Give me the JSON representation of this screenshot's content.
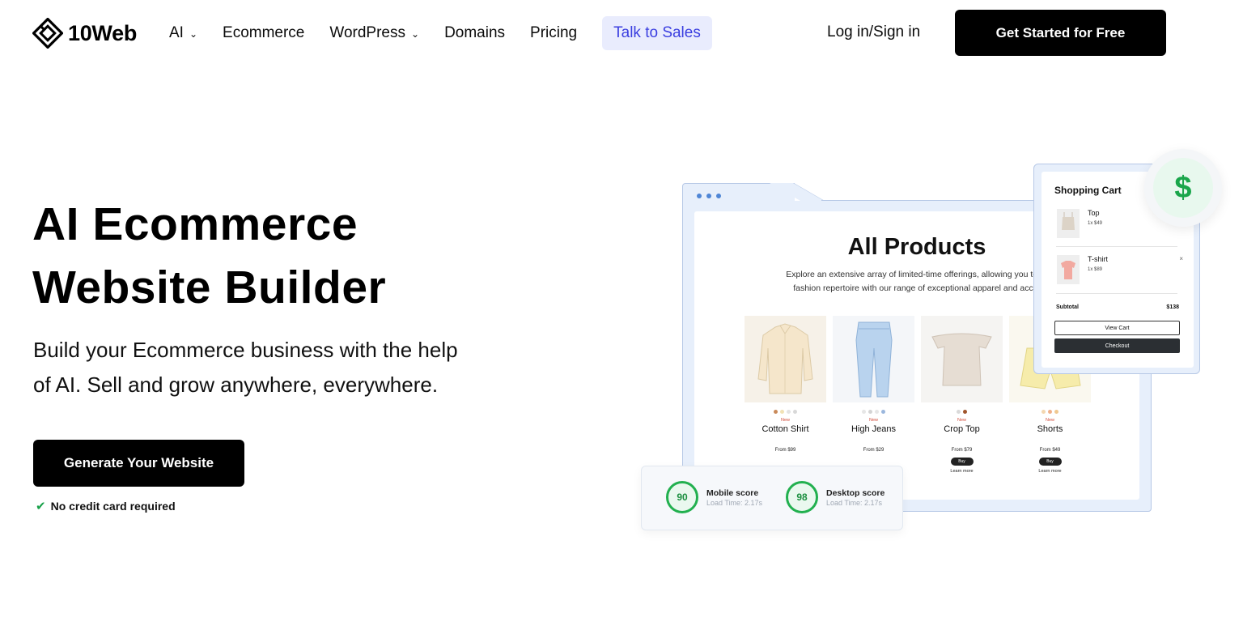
{
  "brand": {
    "name": "10Web"
  },
  "nav": {
    "items": [
      {
        "label": "AI",
        "has_dropdown": true
      },
      {
        "label": "Ecommerce",
        "has_dropdown": false
      },
      {
        "label": "WordPress",
        "has_dropdown": true
      },
      {
        "label": "Domains",
        "has_dropdown": false
      },
      {
        "label": "Pricing",
        "has_dropdown": false
      }
    ],
    "talk_to_sales": "Talk to Sales",
    "login": "Log in/Sign in",
    "cta": "Get Started for Free",
    "chevron": "⌄"
  },
  "hero": {
    "title_line1": "AI Ecommerce",
    "title_line2": "Website Builder",
    "subtitle_line1": "Build your Ecommerce business with the help",
    "subtitle_line2": "of AI. Sell and grow anywhere, everywhere.",
    "button": "Generate Your Website",
    "note": "No credit card required"
  },
  "shop_preview": {
    "title": "All Products",
    "description_line1": "Explore an extensive array of limited-time offerings, allowing you to en",
    "description_line2": "fashion repertoire with our range of exceptional apparel and acces",
    "products": [
      {
        "badge": "New",
        "name": "Cotton Shirt",
        "price": "From $99",
        "buy": "",
        "learn": "",
        "dots": [
          "#c98a5a",
          "#f1e2b5",
          "#e3e3e3",
          "#d8d8d8"
        ]
      },
      {
        "badge": "New",
        "name": "High Jeans",
        "price": "From $29",
        "buy": "",
        "learn": "",
        "dots": [
          "#e6e6e6",
          "#d4d4d4",
          "#e6e6e6",
          "#9bb7dd"
        ]
      },
      {
        "badge": "New",
        "name": "Crop Top",
        "price": "From $79",
        "buy": "Buy",
        "learn": "Learn more",
        "dots": [
          "#d9d9d9",
          "#a0552c"
        ]
      },
      {
        "badge": "New",
        "name": "Shorts",
        "price": "From $49",
        "buy": "Buy",
        "learn": "Learn more",
        "dots": [
          "#f3d7b0",
          "#f0b08a",
          "#f0c890"
        ]
      }
    ]
  },
  "cart": {
    "title": "Shopping Cart",
    "items": [
      {
        "name": "Top",
        "qty": "1x $49",
        "remove": ""
      },
      {
        "name": "T-shirt",
        "qty": "1x $89",
        "remove": "×"
      }
    ],
    "subtotal_label": "Subtotal",
    "subtotal_value": "$138",
    "view_cart": "View Cart",
    "checkout": "Checkout",
    "badge_symbol": "$"
  },
  "scores": [
    {
      "value": "90",
      "label": "Mobile score",
      "time": "Load Time: 2.17s"
    },
    {
      "value": "98",
      "label": "Desktop score",
      "time": "Load Time: 2.17s"
    }
  ],
  "colors": {
    "accent_sales_bg": "#e9ecfd",
    "accent_sales_text": "#3a3ee0",
    "success_green": "#1aa64b",
    "cta_bg": "#000000"
  }
}
